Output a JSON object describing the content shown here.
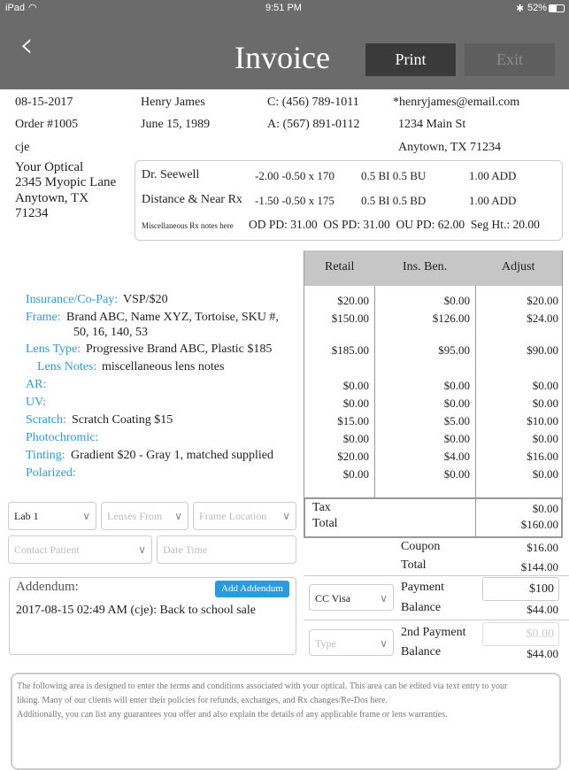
{
  "status": {
    "device": "iPad",
    "time": "9:51 PM",
    "battery": "52%"
  },
  "header": {
    "title": "Invoice",
    "print": "Print",
    "exit": "Exit"
  },
  "info": {
    "date": "08-15-2017",
    "order": "Order #1005",
    "user": "cje",
    "name": "Henry James",
    "dob": "June 15, 1989",
    "cell": "C: (456) 789-1011",
    "alt": "A: (567) 891-0112",
    "email": "*henryjames@email.com",
    "street": "1234 Main St",
    "city": "Anytown, TX 71234"
  },
  "store": {
    "name": "Your Optical",
    "street": "2345 Myopic Lane",
    "city": "Anytown, TX",
    "zip": "71234"
  },
  "rx": {
    "r1": [
      "Dr. Seewell",
      "-2.00 -0.50 x 170",
      "0.5 BI 0.5 BU",
      "1.00 ADD"
    ],
    "r2": [
      "Distance & Near Rx",
      "-1.50 -0.50 x 175",
      "0.5 BI 0.5 BD",
      "1.00 ADD"
    ],
    "notes": "Miscellaneous Rx notes here",
    "pd": "OD PD: 31.00  OS PD: 31.00  OU PD: 62.00  Seg Ht.: 20.00"
  },
  "table": {
    "headers": [
      "Retail",
      "Ins. Ben.",
      "Adjust"
    ],
    "rows": [
      {
        "label": "Insurance/Co-Pay:",
        "value": "VSP/$20",
        "retail": "$20.00",
        "ins": "$0.00",
        "adj": "$20.00"
      },
      {
        "label": "Frame:",
        "value": "Brand ABC, Name XYZ, Tortoise, SKU #,",
        "value2": "50, 16, 140, 53",
        "retail": "$150.00",
        "ins": "$126.00",
        "adj": "$24.00"
      },
      {
        "label": "Lens Type:",
        "value": "Progressive Brand ABC, Plastic $185",
        "retail": "$185.00",
        "ins": "$95.00",
        "adj": "$90.00"
      },
      {
        "label": "Lens Notes:",
        "value": "miscellaneous lens notes"
      },
      {
        "label": "AR:",
        "value": "",
        "retail": "$0.00",
        "ins": "$0.00",
        "adj": "$0.00"
      },
      {
        "label": "UV:",
        "value": "",
        "retail": "$0.00",
        "ins": "$0.00",
        "adj": "$0.00"
      },
      {
        "label": "Scratch:",
        "value": "Scratch Coating $15",
        "retail": "$15.00",
        "ins": "$5.00",
        "adj": "$10.00"
      },
      {
        "label": "Photochromic:",
        "value": "",
        "retail": "$0.00",
        "ins": "$0.00",
        "adj": "$0.00"
      },
      {
        "label": "Tinting:",
        "value": "Gradient $20 - Gray 1, matched supplied",
        "retail": "$20.00",
        "ins": "$4.00",
        "adj": "$16.00"
      },
      {
        "label": "Polarized:",
        "value": "",
        "retail": "$0.00",
        "ins": "$0.00",
        "adj": "$0.00"
      }
    ],
    "tax_label": "Tax",
    "tax": "$0.00",
    "total_label": "Total",
    "total": "$160.00"
  },
  "summary": {
    "coupon_label": "Coupon",
    "coupon": "$16.00",
    "total_label": "Total",
    "total": "$144.00",
    "payment_type": "CC Visa",
    "payment_label": "Payment",
    "payment": "$100",
    "balance_label": "Balance",
    "balance": "$44.00",
    "type_placeholder": "Type",
    "payment2_label": "2nd Payment",
    "payment2_placeholder": "$0.00",
    "balance2_label": "Balance",
    "balance2": "$44.00"
  },
  "selects": {
    "lab": "Lab 1",
    "lenses_from": "Lenses From",
    "frame_location": "Frame Location",
    "contact_patient": "Contact Patient",
    "date_time": "Date Time"
  },
  "addendum": {
    "title": "Addendum:",
    "button": "Add Addendum",
    "entry": "2017-08-15 02:49 AM (cje): Back to school sale"
  },
  "terms": {
    "l1": "The following area is designed to enter the terms and conditions associated with your optical.  This area can be edited via text entry to your",
    "l2": "liking.  Many of our clients will enter their policies for refunds, exchanges, and Rx changes/Re-Dos here.",
    "l3": "Additionally, you can list any guarantees you offer and also explain the details of any applicable frame or lens warranties."
  }
}
